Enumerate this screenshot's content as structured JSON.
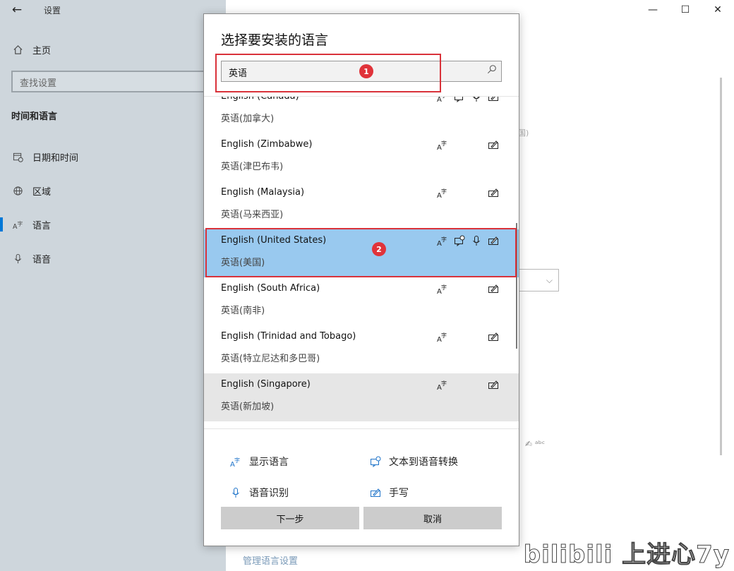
{
  "window": {
    "title": "设置",
    "back_icon": "←",
    "minimize": "—",
    "maximize": "☐",
    "close": "✕"
  },
  "sidebar": {
    "home_label": "主页",
    "search_placeholder": "查找设置",
    "section": "时间和语言",
    "items": [
      {
        "label": "日期和时间",
        "icon": "calendar-clock-icon"
      },
      {
        "label": "区域",
        "icon": "globe-icon"
      },
      {
        "label": "语言",
        "icon": "language-icon"
      },
      {
        "label": "语音",
        "icon": "microphone-icon"
      }
    ]
  },
  "background": {
    "link_text": "管理语言设置"
  },
  "dialog": {
    "title": "选择要安装的语言",
    "search_value": "英语",
    "annotations": [
      "1",
      "2"
    ],
    "languages": [
      {
        "en": "English (Canada)",
        "zh": "英语(加拿大)",
        "features": [
          "display",
          "tts",
          "speech",
          "handwriting"
        ],
        "state": "normal"
      },
      {
        "en": "English (Zimbabwe)",
        "zh": "英语(津巴布韦)",
        "features": [
          "display",
          "handwriting"
        ],
        "state": "normal"
      },
      {
        "en": "English (Malaysia)",
        "zh": "英语(马来西亚)",
        "features": [
          "display",
          "handwriting"
        ],
        "state": "normal"
      },
      {
        "en": "English (United States)",
        "zh": "英语(美国)",
        "features": [
          "display",
          "tts",
          "speech",
          "handwriting"
        ],
        "state": "selected"
      },
      {
        "en": "English (South Africa)",
        "zh": "英语(南非)",
        "features": [
          "display",
          "handwriting"
        ],
        "state": "normal"
      },
      {
        "en": "English (Trinidad and Tobago)",
        "zh": "英语(特立尼达和多巴哥)",
        "features": [
          "display",
          "handwriting"
        ],
        "state": "normal"
      },
      {
        "en": "English (Singapore)",
        "zh": "英语(新加坡)",
        "features": [
          "display",
          "handwriting"
        ],
        "state": "hover"
      }
    ],
    "legend": {
      "display": "显示语言",
      "tts": "文本到语音转换",
      "speech": "语音识别",
      "handwriting": "手写"
    },
    "buttons": {
      "next": "下一步",
      "cancel": "取消"
    },
    "colors": {
      "selected_bg": "#99c9ef",
      "hover_bg": "#e6e6e6",
      "annotation": "#e0333a",
      "accent": "#0078d7"
    }
  },
  "watermark": "bilibili 上进心7y"
}
